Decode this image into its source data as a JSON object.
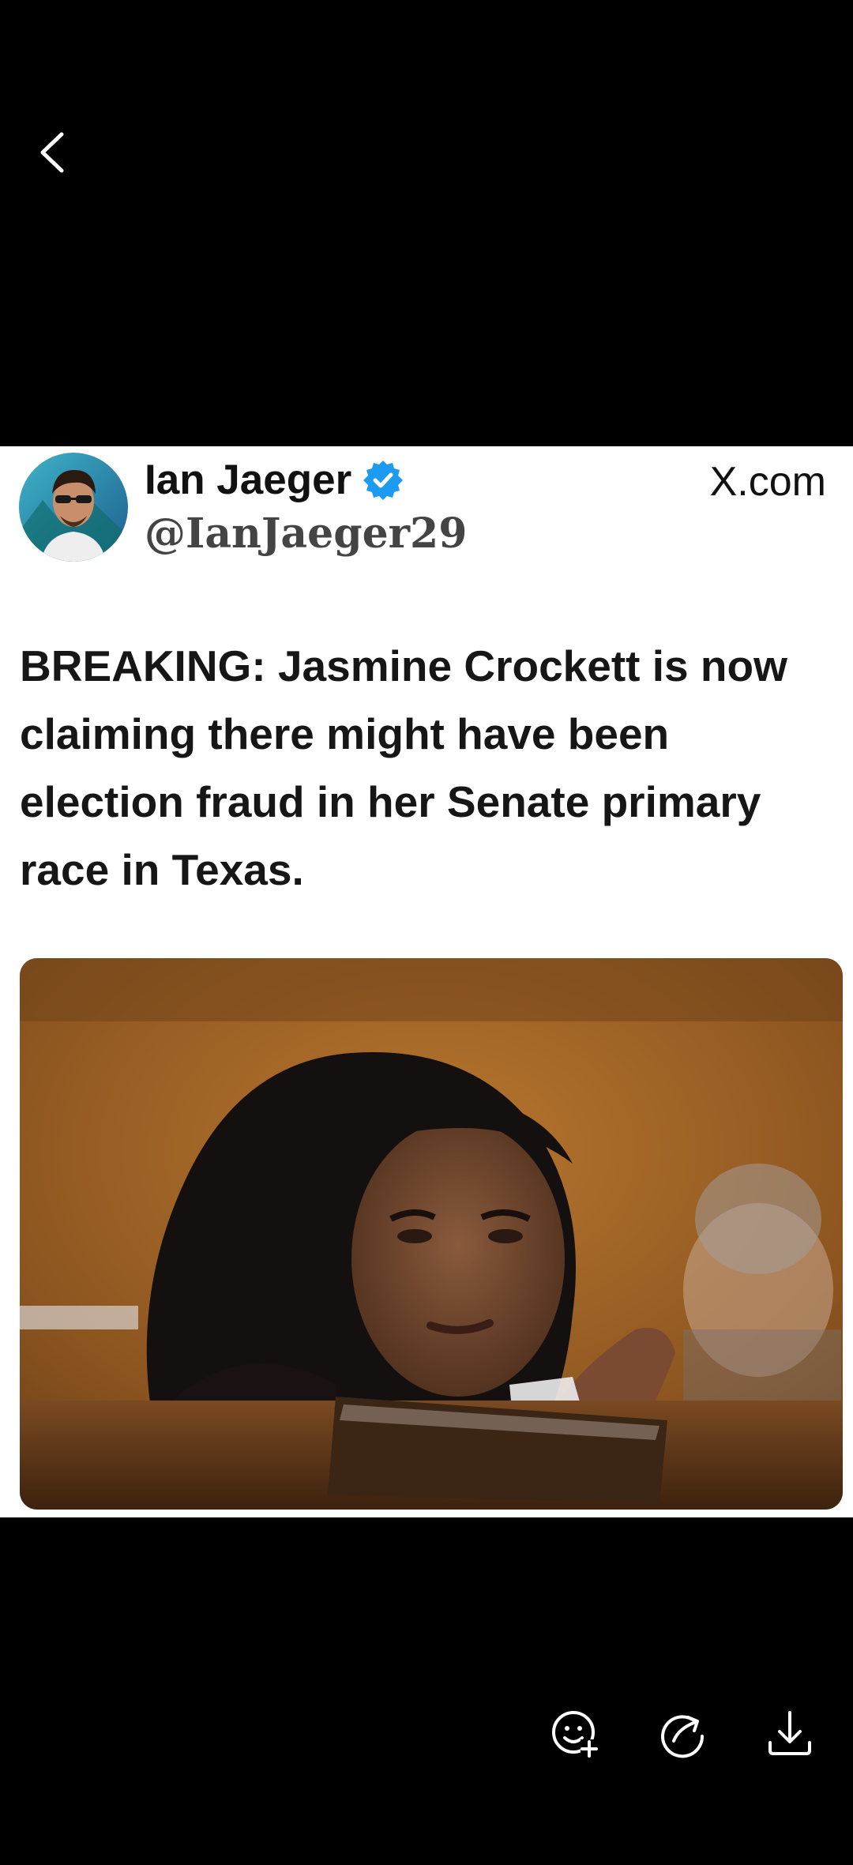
{
  "nav": {
    "back_icon": "chevron-left-icon"
  },
  "post": {
    "author_name": "Ian Jaeger",
    "handle": "@IanJaeger29",
    "site": "X.com",
    "headline": "BREAKING: Jasmine Crockett is now claiming there might have been election fraud in her Senate primary race in Texas."
  },
  "actions": {
    "icons": [
      "sticker-add-icon",
      "share-icon",
      "download-icon"
    ]
  },
  "colors": {
    "background": "#000000",
    "card": "#ffffff",
    "verified": "#1d9bf0"
  }
}
